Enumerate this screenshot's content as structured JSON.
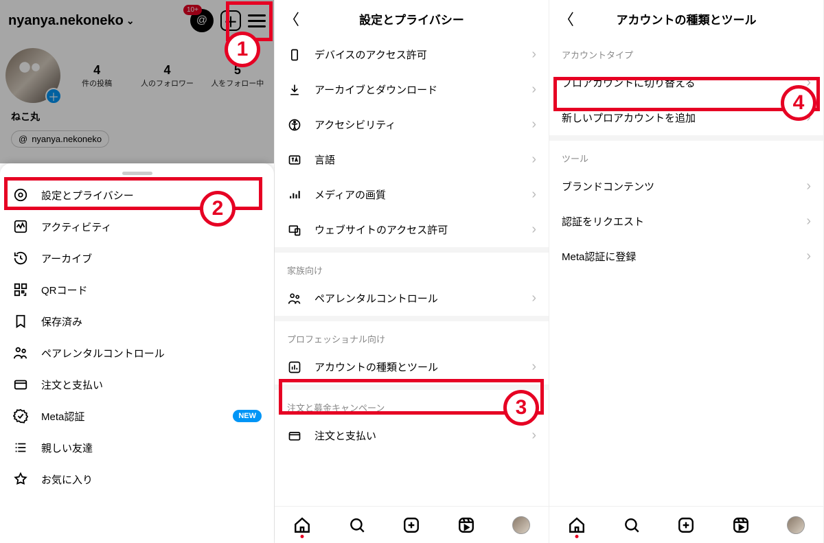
{
  "panel1": {
    "username": "nyanya.nekoneko",
    "badge_text": "10+",
    "stats": [
      {
        "num": "4",
        "label": "件の投稿"
      },
      {
        "num": "4",
        "label": "人のフォロワー"
      },
      {
        "num": "5",
        "label": "人をフォロー中"
      }
    ],
    "display_name": "ねこ丸",
    "threads_handle": "nyanya.nekoneko",
    "sheet_items": [
      {
        "icon": "⚙︎",
        "label": "設定とプライバシー"
      },
      {
        "icon": "⏱",
        "label": "アクティビティ"
      },
      {
        "icon": "↺",
        "label": "アーカイブ"
      },
      {
        "icon": "㗊",
        "label": "QRコード"
      },
      {
        "icon": "🔖",
        "label": "保存済み"
      },
      {
        "icon": "👥",
        "label": "ペアレンタルコントロール"
      },
      {
        "icon": "💳",
        "label": "注文と支払い"
      },
      {
        "icon": "✔︎",
        "label": "Meta認証",
        "new": "NEW"
      },
      {
        "icon": "≣",
        "label": "親しい友達"
      },
      {
        "icon": "☆",
        "label": "お気に入り"
      }
    ]
  },
  "panel2": {
    "title": "設定とプライバシー",
    "rows_a": [
      {
        "icon": "▭",
        "label": "デバイスのアクセス許可"
      },
      {
        "icon": "⭳",
        "label": "アーカイブとダウンロード"
      },
      {
        "icon": "♿︎",
        "label": "アクセシビリティ"
      },
      {
        "icon": "🄰",
        "label": "言語"
      },
      {
        "icon": "ıll",
        "label": "メディアの画質"
      },
      {
        "icon": "⌂",
        "label": "ウェブサイトのアクセス許可"
      }
    ],
    "section_family": "家族向け",
    "rows_family": [
      {
        "icon": "👥",
        "label": "ペアレンタルコントロール"
      }
    ],
    "section_pro": "プロフェッショナル向け",
    "rows_pro": [
      {
        "icon": "⊞",
        "label": "アカウントの種類とツール"
      }
    ],
    "section_order": "注文と募金キャンペーン",
    "rows_order": [
      {
        "icon": "💳",
        "label": "注文と支払い"
      }
    ]
  },
  "panel3": {
    "title": "アカウントの種類とツール",
    "section_type": "アカウントタイプ",
    "rows_type": [
      {
        "label": "プロアカウントに切り替える"
      },
      {
        "label": "新しいプロアカウントを追加"
      }
    ],
    "section_tools": "ツール",
    "rows_tools": [
      {
        "label": "ブランドコンテンツ"
      },
      {
        "label": "認証をリクエスト"
      },
      {
        "label": "Meta認証に登録"
      }
    ]
  },
  "callouts": {
    "c1": "1",
    "c2": "2",
    "c3": "3",
    "c4": "4"
  }
}
